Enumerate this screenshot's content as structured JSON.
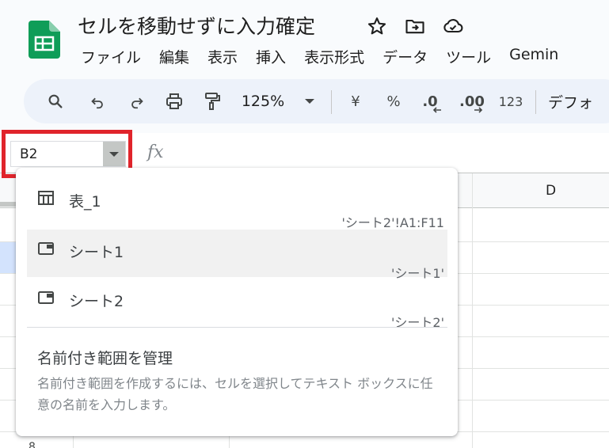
{
  "document": {
    "title": "セルを移動せずに入力確定"
  },
  "menu": [
    "ファイル",
    "編集",
    "表示",
    "挿入",
    "表示形式",
    "データ",
    "ツール",
    "Gemin"
  ],
  "toolbar": {
    "zoom": "125%",
    "currency": "¥",
    "percent": "%",
    "decrease_decimal": ".0",
    "increase_decimal": ".00",
    "format_number": "123",
    "font": "デフォ"
  },
  "namebox": {
    "value": "B2"
  },
  "formula_bar": {
    "fx_label": "fx"
  },
  "grid": {
    "column_d": "D",
    "row_8": "8"
  },
  "dropdown": {
    "items": [
      {
        "label": "表_1",
        "range": "'シート2'!A1:F11",
        "icon": "table-icon"
      },
      {
        "label": "シート1",
        "range": "'シート1'",
        "icon": "sheet-icon"
      },
      {
        "label": "シート2",
        "range": "'シート2'",
        "icon": "sheet-icon"
      }
    ],
    "manage_title": "名前付き範囲を管理",
    "manage_desc": "名前付き範囲を作成するには、セルを選択してテキスト ボックスに任意の名前を入力します。"
  },
  "colors": {
    "highlight_outline": "#e0242b",
    "sheets_green": "#0f9d58",
    "toolbar_bg": "#edf2fa",
    "selected_row": "#d3e3fd"
  }
}
